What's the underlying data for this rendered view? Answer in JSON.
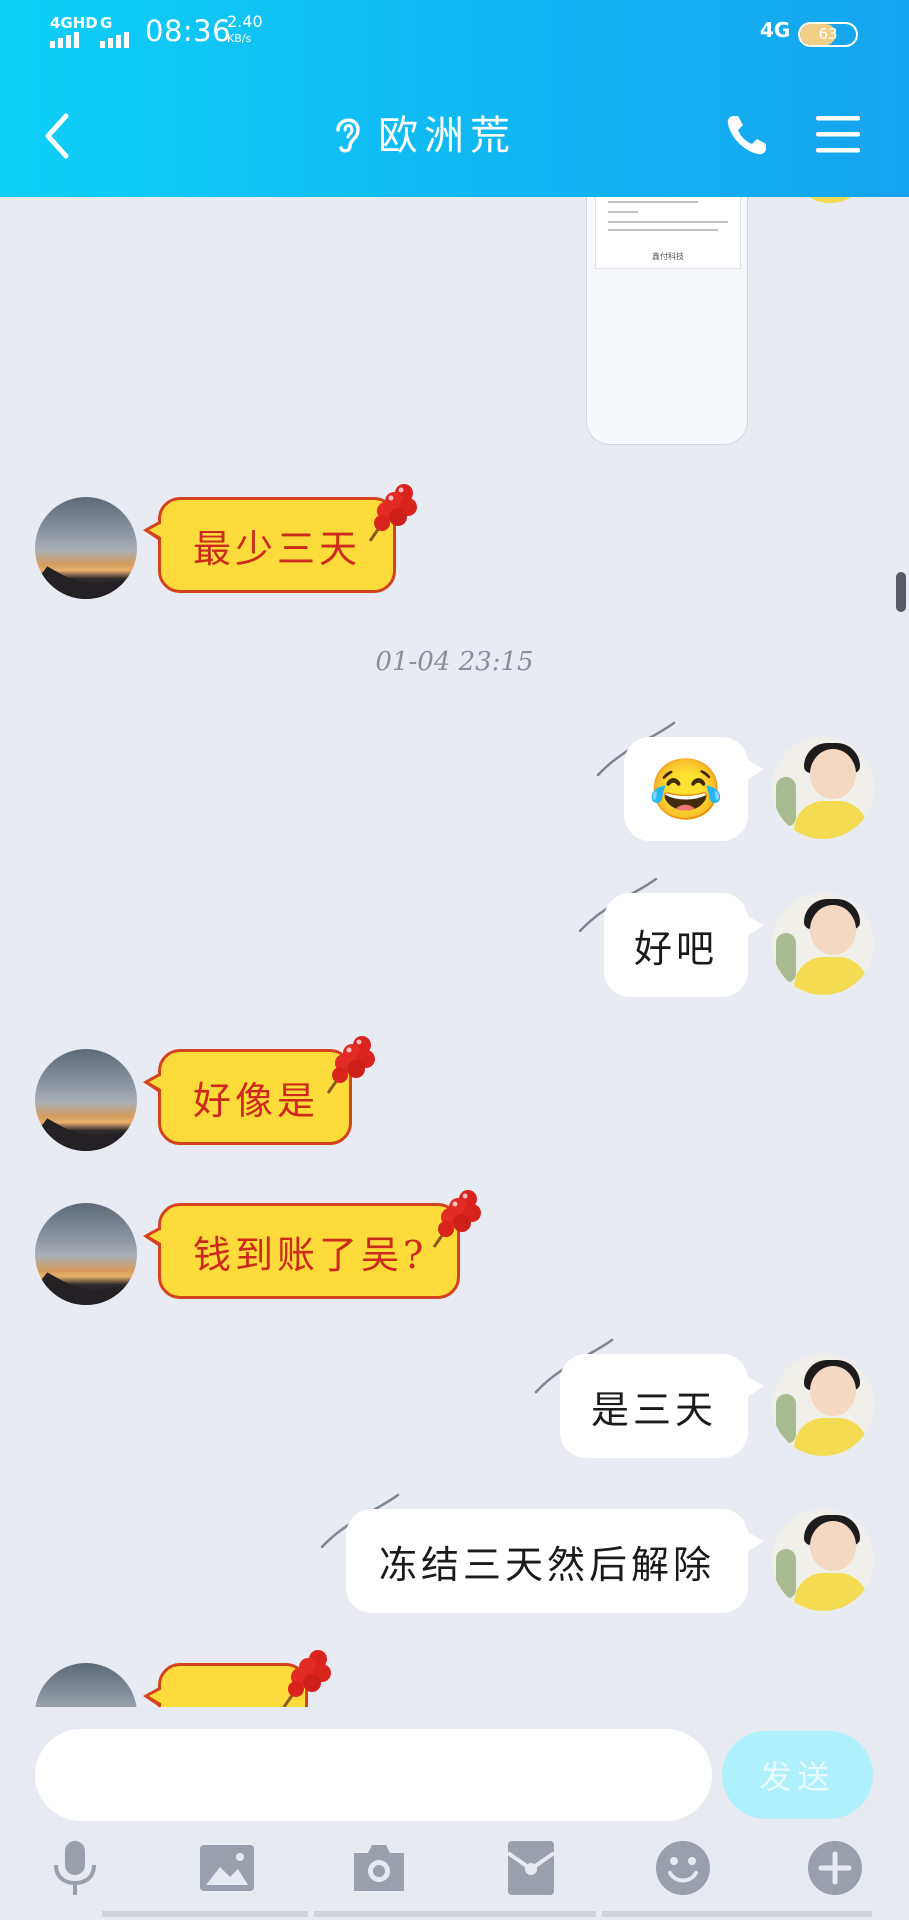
{
  "status_bar": {
    "network_left": "4GHD",
    "network_left2": "G",
    "time": "08:36",
    "speed_value": "2.40",
    "speed_unit": "KB/s",
    "network_right": "4G",
    "battery": "63"
  },
  "header": {
    "title": "欧洲荒",
    "colors": {
      "gradient_start": "#0fd0f7",
      "gradient_end": "#16a4ee"
    }
  },
  "receipt_preview": {
    "sign_text": "鑫付科技"
  },
  "messages": [
    {
      "side": "left",
      "style": "candy-yellow",
      "text": "最少三天"
    },
    {
      "type": "timestamp",
      "text": "01-04 23:15"
    },
    {
      "side": "right",
      "style": "white",
      "text": "😂"
    },
    {
      "side": "right",
      "style": "white",
      "text": "好吧"
    },
    {
      "side": "left",
      "style": "candy-yellow",
      "text": "好像是"
    },
    {
      "side": "left",
      "style": "candy-yellow",
      "text": "钱到账了吴?"
    },
    {
      "side": "right",
      "style": "white",
      "text": "是三天"
    },
    {
      "side": "right",
      "style": "white",
      "text": "冻结三天然后解除"
    }
  ],
  "input": {
    "value": "",
    "placeholder": "",
    "send_label": "发送"
  },
  "toolbar": {
    "icons": [
      "microphone-icon",
      "image-icon",
      "camera-icon",
      "red-packet-icon",
      "emoji-icon",
      "plus-icon"
    ],
    "icon_color": "#9aa0ab"
  }
}
